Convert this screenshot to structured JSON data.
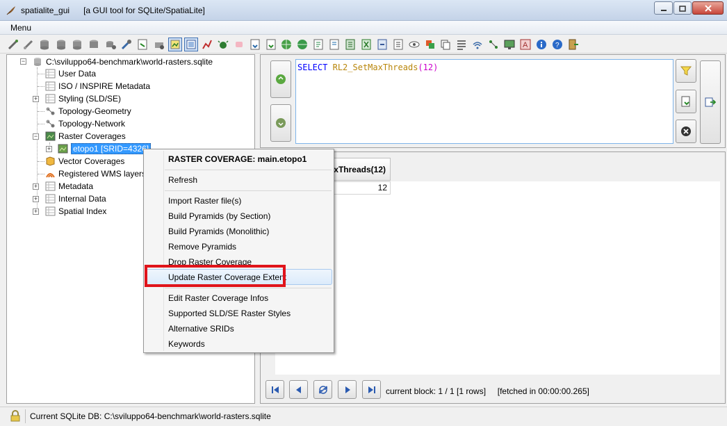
{
  "window": {
    "app_name": "spatialite_gui",
    "subtitle": "[a GUI tool for SQLite/SpatiaLite]"
  },
  "menubar": {
    "menu_label": "Menu"
  },
  "tree": {
    "root": "C:\\sviluppo64-benchmark\\world-rasters.sqlite",
    "items": [
      {
        "label": "User Data"
      },
      {
        "label": "ISO / INSPIRE Metadata"
      },
      {
        "label": "Styling (SLD/SE)"
      },
      {
        "label": "Topology-Geometry"
      },
      {
        "label": "Topology-Network"
      },
      {
        "label": "Raster Coverages"
      },
      {
        "label": "etopo1 [SRID=4326]"
      },
      {
        "label": "Vector Coverages"
      },
      {
        "label": "Registered WMS layers"
      },
      {
        "label": "Metadata"
      },
      {
        "label": "Internal Data"
      },
      {
        "label": "Spatial Index"
      }
    ]
  },
  "sql": {
    "keyword": "SELECT",
    "function": "RL2_SetMaxThreads",
    "open_paren": "(",
    "argument": "12",
    "close_paren": ")"
  },
  "result": {
    "column_header": "RL2_SetMaxThreads(12)",
    "cell_value": "12",
    "block_info": "current block: 1 / 1 [1 rows]     [fetched in 00:00:00.265]"
  },
  "context_menu": {
    "header": "RASTER COVERAGE: main.etopo1",
    "refresh": "Refresh",
    "import_raster": "Import Raster file(s)",
    "build_pyramids_section": "Build Pyramids (by Section)",
    "build_pyramids_mono": "Build Pyramids (Monolithic)",
    "remove_pyramids": "Remove Pyramids",
    "drop_coverage": "Drop Raster Coverage",
    "update_extent": "Update Raster Coverage Extent",
    "edit_infos": "Edit Raster Coverage Infos",
    "supported_styles": "Supported SLD/SE Raster Styles",
    "alternative_srids": "Alternative SRIDs",
    "keywords": "Keywords"
  },
  "status": {
    "text": "Current SQLite DB: C:\\sviluppo64-benchmark\\world-rasters.sqlite"
  },
  "colors": {
    "selection": "#3399ff",
    "highlight": "#e0141b",
    "keyword": "#0000ff",
    "function": "#b8860b",
    "number": "#cc00cc"
  }
}
